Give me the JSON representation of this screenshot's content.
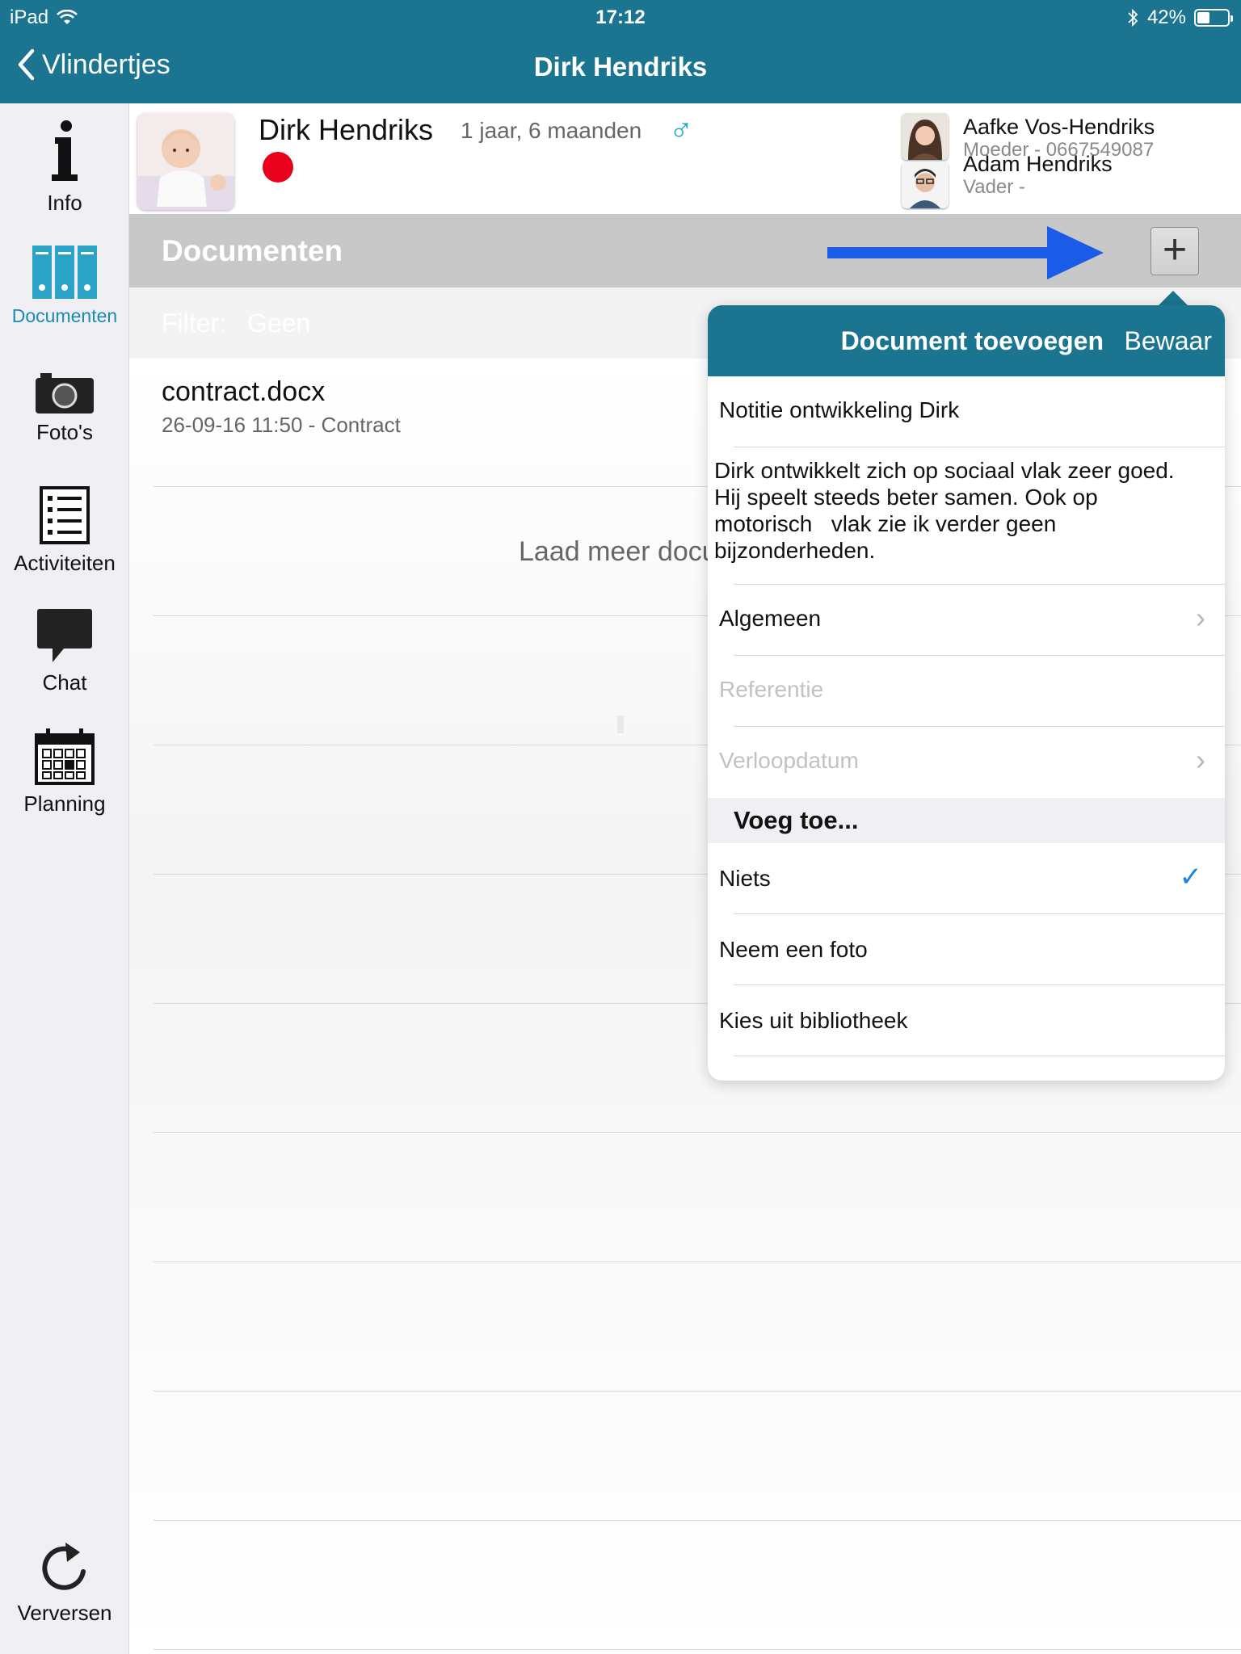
{
  "status": {
    "device": "iPad",
    "time": "17:12",
    "battery": "42%",
    "battery_level": 0.42
  },
  "nav": {
    "back_label": "Vlindertjes",
    "title": "Dirk Hendriks"
  },
  "sidebar": {
    "items": [
      {
        "label": "Info",
        "icon": "info-icon"
      },
      {
        "label": "Documenten",
        "icon": "binders-icon",
        "active": true
      },
      {
        "label": "Foto's",
        "icon": "camera-icon"
      },
      {
        "label": "Activiteiten",
        "icon": "checklist-icon"
      },
      {
        "label": "Chat",
        "icon": "speech-bubble-icon"
      },
      {
        "label": "Planning",
        "icon": "calendar-icon"
      }
    ],
    "refresh_label": "Verversen"
  },
  "profile": {
    "name": "Dirk Hendriks",
    "age": "1 jaar, 6 maanden",
    "gender_symbol": "♂",
    "status_color": "#e8001d",
    "parents": [
      {
        "name": "Aafke Vos-Hendriks",
        "role": "Moeder - 0667549087"
      },
      {
        "name": "Adam Hendriks",
        "role": "Vader -"
      }
    ]
  },
  "section": {
    "title": "Documenten",
    "add_label": "+"
  },
  "filter": {
    "label": "Filter:",
    "value": "Geen"
  },
  "documents": [
    {
      "name": "contract.docx",
      "meta": "26-09-16 11:50 - Contract"
    }
  ],
  "load_more": "Laad meer documenten",
  "popover": {
    "title": "Document toevoegen",
    "save": "Bewaar",
    "doc_title": "Notitie ontwikkeling Dirk",
    "notes_lines": [
      "Dirk ontwikkelt zich op sociaal vlak zeer goed.",
      "Hij speelt steeds beter samen. Ook op",
      "motorisch   vlak zie ik verder geen",
      "bijzonderheden."
    ],
    "category": "Algemeen",
    "reference_placeholder": "Referentie",
    "expiry_placeholder": "Verloopdatum",
    "attach_header": "Voeg toe...",
    "attach_options": [
      {
        "label": "Niets",
        "selected": true
      },
      {
        "label": "Neem een foto",
        "selected": false
      },
      {
        "label": "Kies uit bibliotheek",
        "selected": false
      }
    ]
  },
  "colors": {
    "accent": "#1b7490",
    "sidebar_active": "#1b8bb0",
    "arrow": "#1a5be8",
    "check": "#1a82e2"
  }
}
